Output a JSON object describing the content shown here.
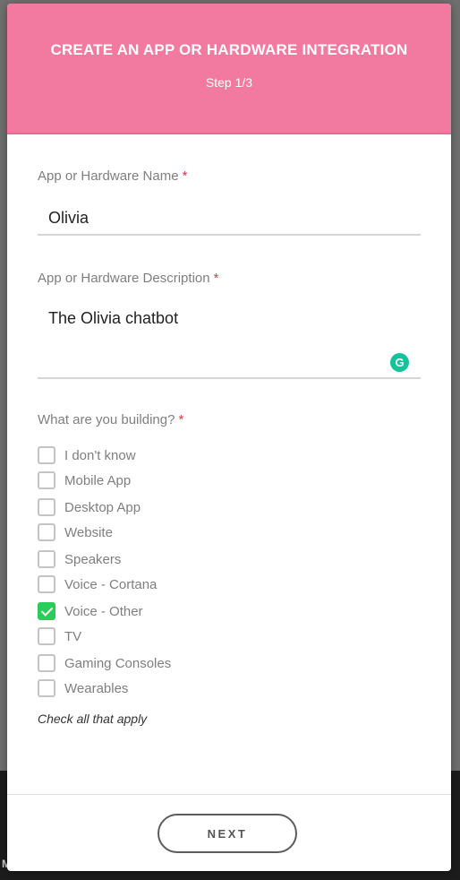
{
  "backdrop": {
    "partial_letter": "M"
  },
  "modal": {
    "title": "CREATE AN APP OR HARDWARE INTEGRATION",
    "step": "Step 1/3",
    "required_marker": "*"
  },
  "fields": {
    "name": {
      "label": "App or Hardware Name",
      "value": "Olivia"
    },
    "description": {
      "label": "App or Hardware Description",
      "value": "The Olivia chatbot",
      "grammarly_icon": "G"
    }
  },
  "building": {
    "label": "What are you building?",
    "options": [
      {
        "label": "I don't know",
        "checked": false
      },
      {
        "label": "Mobile App",
        "checked": false
      },
      {
        "label": "Desktop App",
        "checked": false
      },
      {
        "label": "Website",
        "checked": false
      },
      {
        "label": "Speakers",
        "checked": false
      },
      {
        "label": "Voice - Cortana",
        "checked": false
      },
      {
        "label": "Voice - Other",
        "checked": true
      },
      {
        "label": "TV",
        "checked": false
      },
      {
        "label": "Gaming Consoles",
        "checked": false
      },
      {
        "label": "Wearables",
        "checked": false
      }
    ],
    "hint": "Check all that apply"
  },
  "footer": {
    "next_label": "NEXT"
  },
  "colors": {
    "header": "#f279a0",
    "checked": "#2bcd5a",
    "required": "#e0394e",
    "grammarly": "#15c39a"
  }
}
